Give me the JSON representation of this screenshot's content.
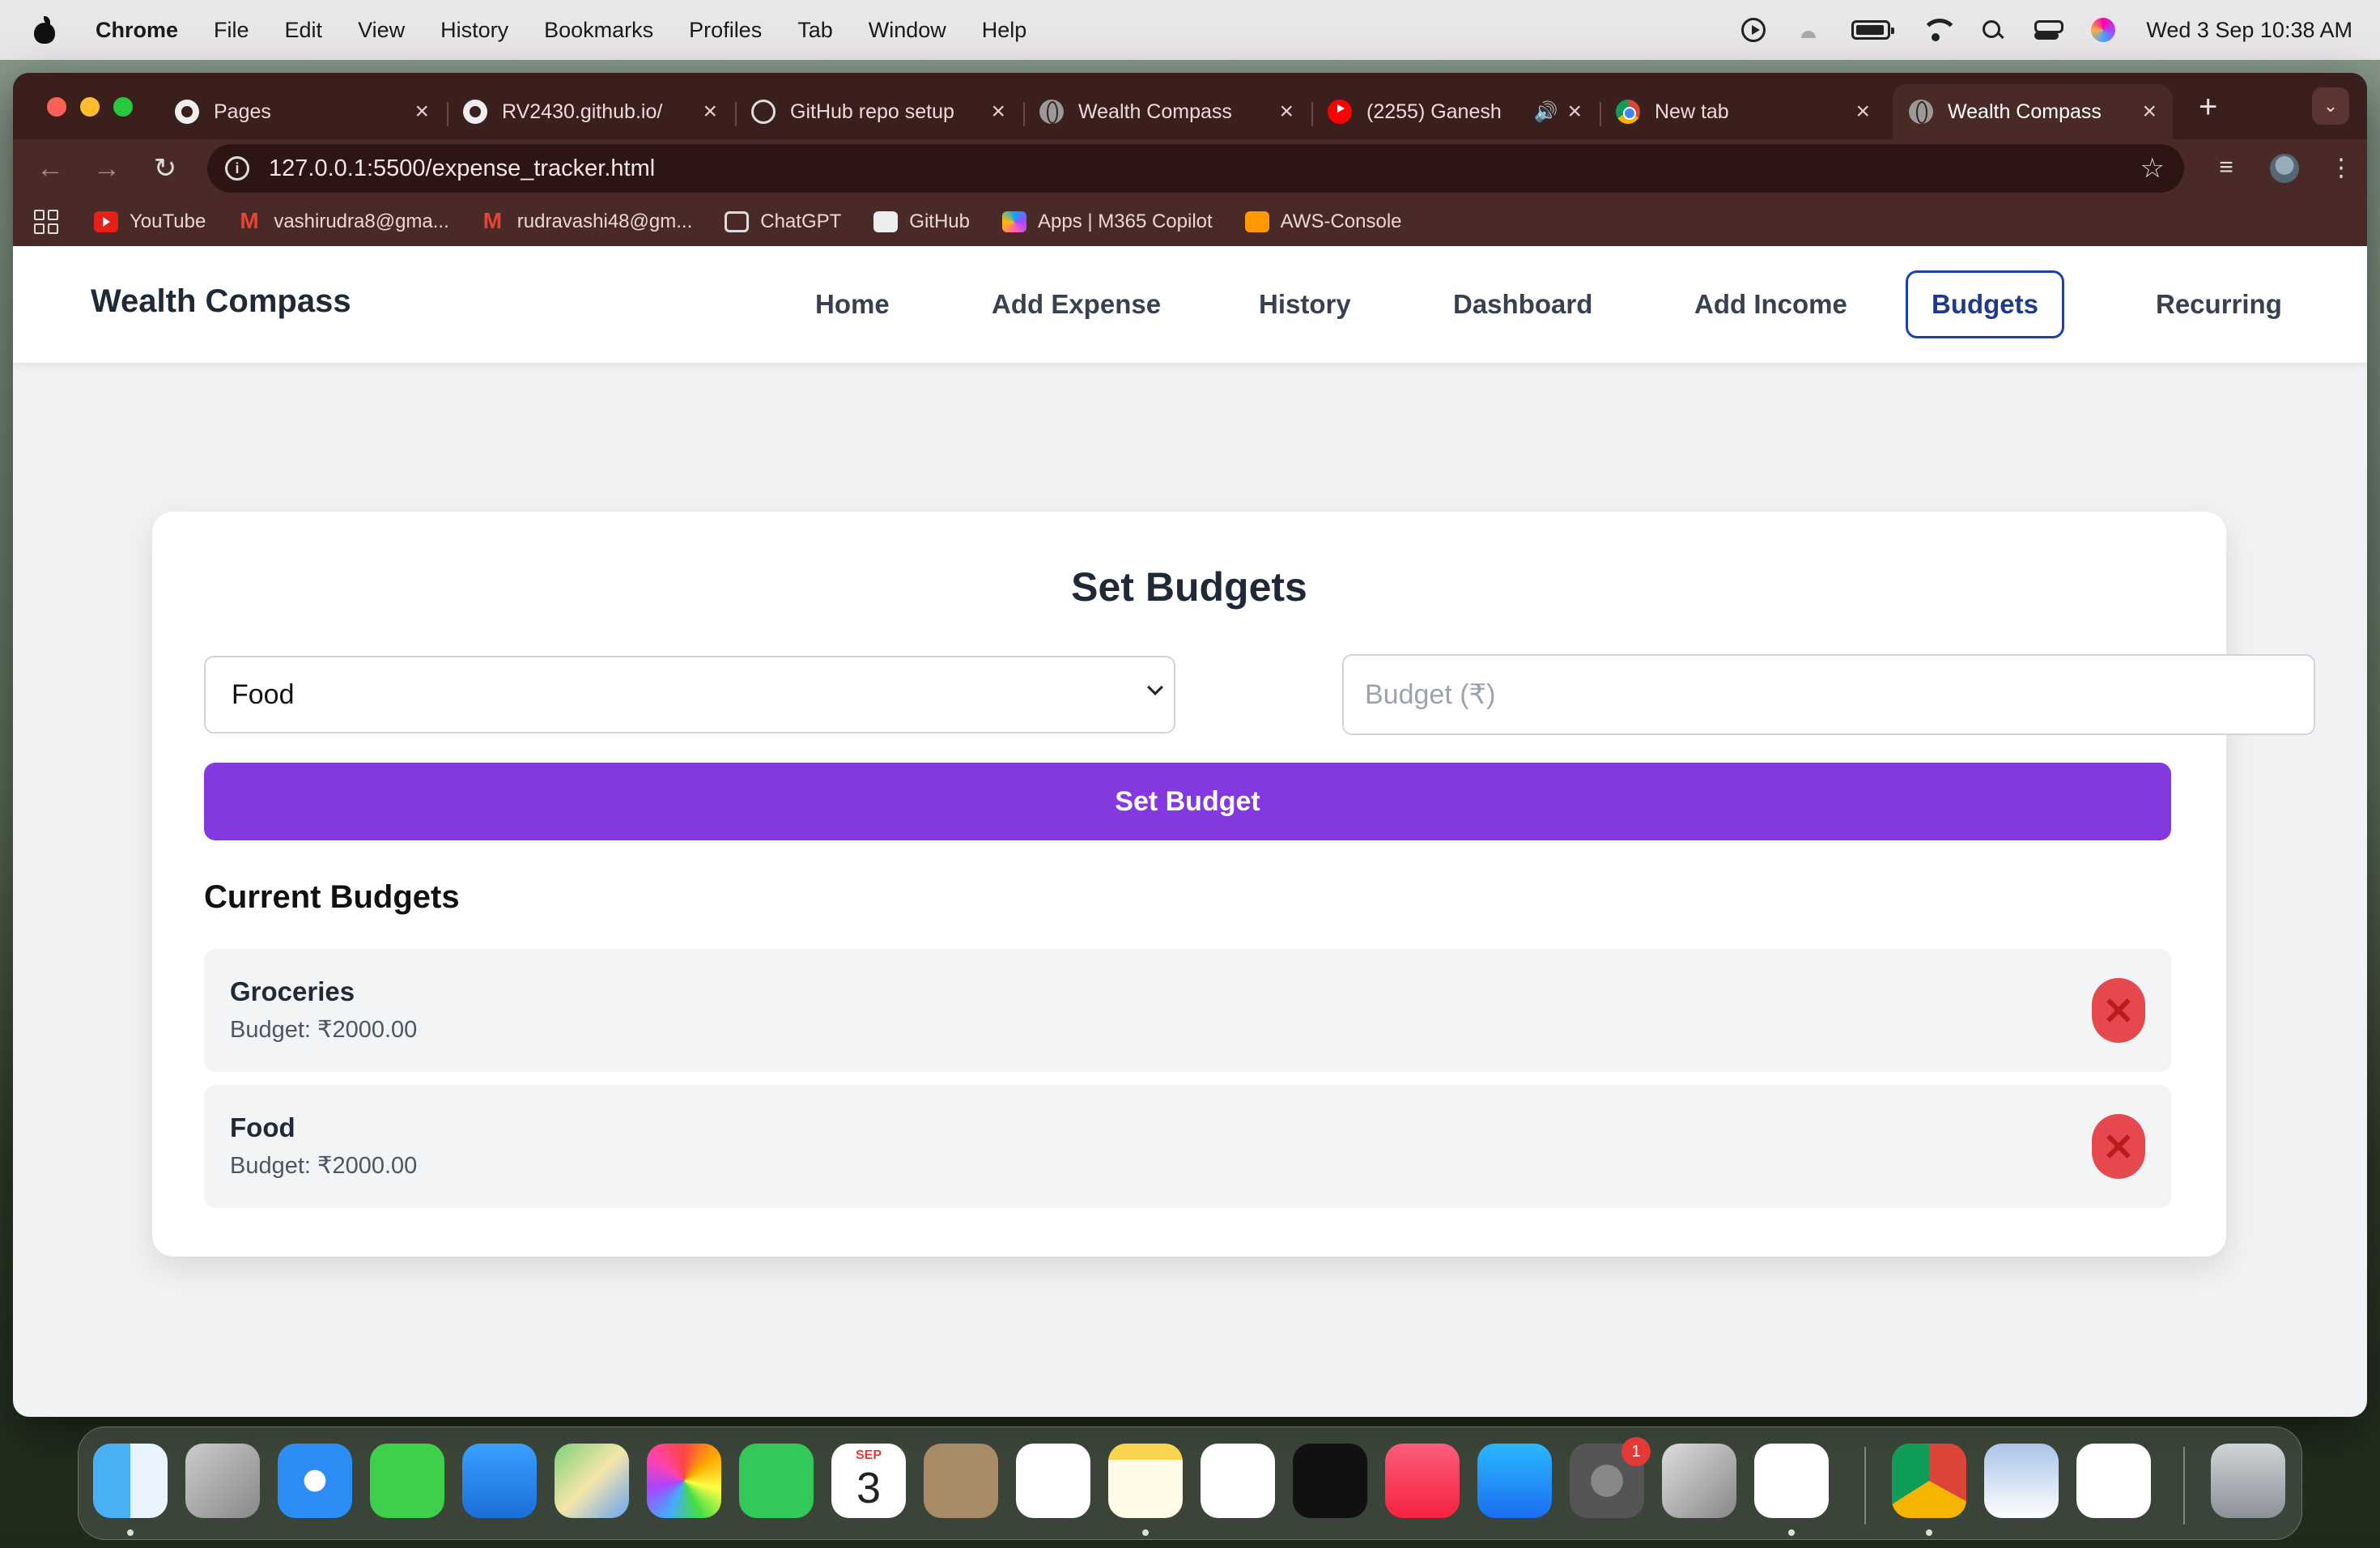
{
  "menubar": {
    "app_name": "Chrome",
    "items": [
      "File",
      "Edit",
      "View",
      "History",
      "Bookmarks",
      "Profiles",
      "Tab",
      "Window",
      "Help"
    ],
    "datetime": "Wed 3 Sep  10:38 AM"
  },
  "browser": {
    "tabs": [
      {
        "title": "Pages",
        "icon": "github-icon"
      },
      {
        "title": "RV2430.github.io/",
        "icon": "github-icon"
      },
      {
        "title": "GitHub repo setup",
        "icon": "chatgpt-icon"
      },
      {
        "title": "Wealth Compass",
        "icon": "globe-icon"
      },
      {
        "title": "(2255) Ganesh",
        "icon": "youtube-icon"
      },
      {
        "title": "New tab",
        "icon": "chrome-icon"
      },
      {
        "title": "Wealth Compass",
        "icon": "globe-icon"
      }
    ],
    "url": "127.0.0.1:5500/expense_tracker.html",
    "bookmarks": [
      {
        "label": "YouTube",
        "icon": "youtube-icon"
      },
      {
        "label": "vashirudra8@gma...",
        "icon": "gmail-icon"
      },
      {
        "label": "rudravashi48@gm...",
        "icon": "gmail-icon"
      },
      {
        "label": "ChatGPT",
        "icon": "chatgpt-icon"
      },
      {
        "label": "GitHub",
        "icon": "github-icon"
      },
      {
        "label": "Apps | M365 Copilot",
        "icon": "m365-icon"
      },
      {
        "label": "AWS-Console",
        "icon": "aws-icon"
      }
    ]
  },
  "site": {
    "brand": "Wealth Compass",
    "nav": [
      "Home",
      "Add Expense",
      "History",
      "Dashboard",
      "Add Income",
      "Budgets",
      "Recurring"
    ],
    "active_nav": "Budgets"
  },
  "budgets": {
    "title": "Set Budgets",
    "category_selected": "Food",
    "amount_placeholder": "Budget (₹)",
    "submit_label": "Set Budget",
    "current_title": "Current Budgets",
    "items": [
      {
        "category": "Groceries",
        "amount": "Budget: ₹2000.00"
      },
      {
        "category": "Food",
        "amount": "Budget: ₹2000.00"
      }
    ]
  },
  "dock": {
    "settings_badge": "1",
    "calendar_month": "SEP",
    "calendar_day": "3"
  },
  "colors": {
    "accent": "#8338e0",
    "delete": "#e5484d",
    "nav_active_border": "#1e40af"
  }
}
